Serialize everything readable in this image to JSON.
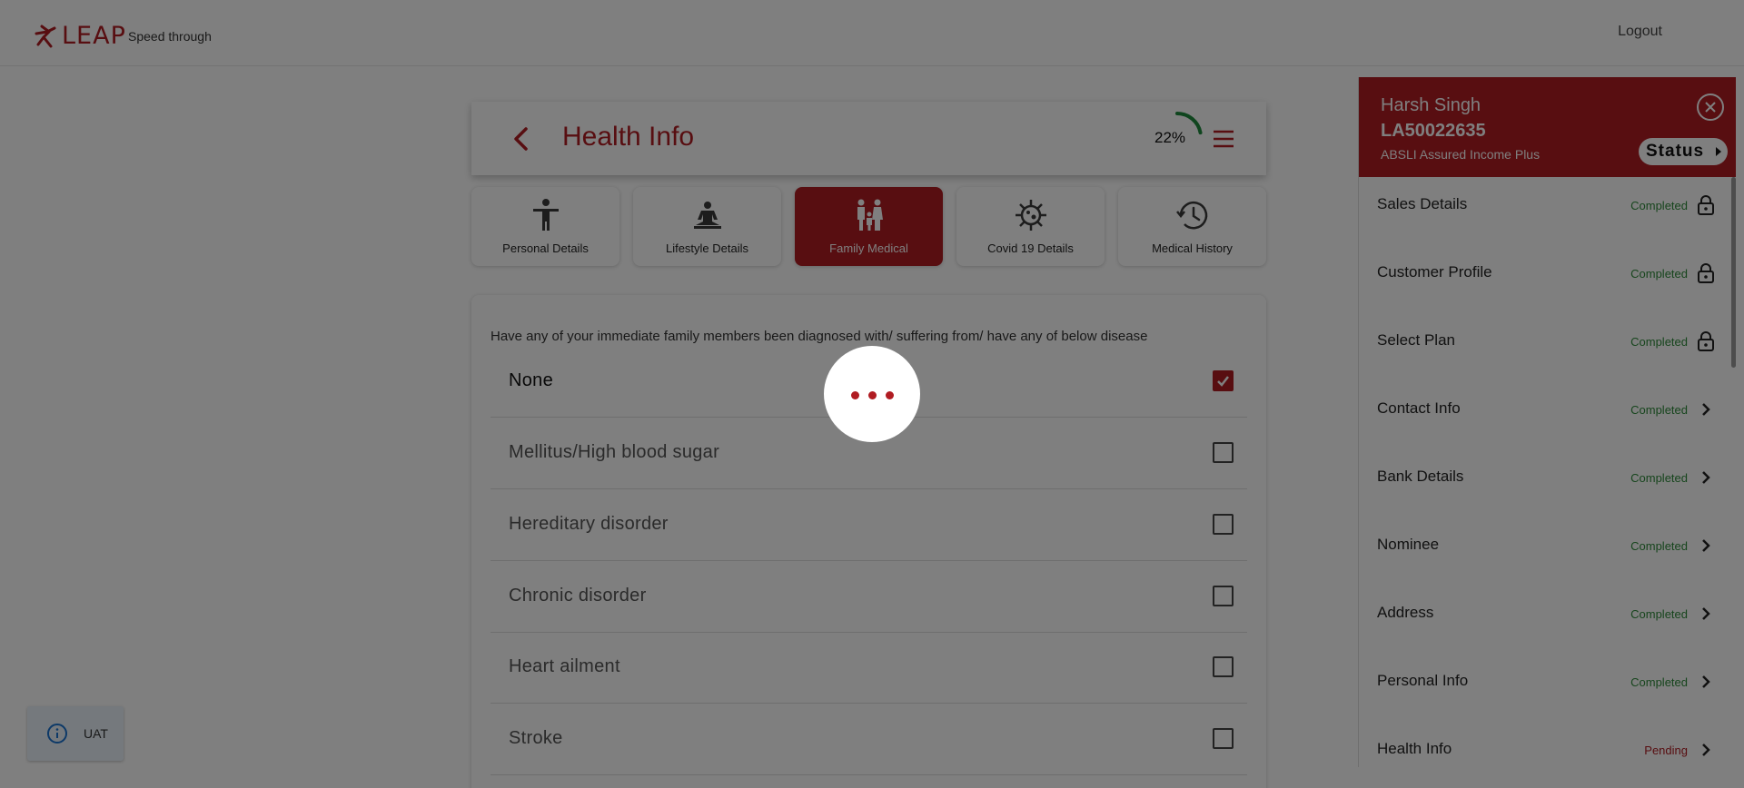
{
  "header": {
    "brand": "LEAP",
    "tagline": "Speed through",
    "logout_label": "Logout"
  },
  "page": {
    "title": "Health Info",
    "progress_percent": 22,
    "progress_label": "22%"
  },
  "tabs": [
    {
      "label": "Personal Details",
      "icon": "person-icon",
      "active": false
    },
    {
      "label": "Lifestyle Details",
      "icon": "meditation-icon",
      "active": false
    },
    {
      "label": "Family Medical",
      "icon": "family-icon",
      "active": true
    },
    {
      "label": "Covid 19 Details",
      "icon": "virus-icon",
      "active": false
    },
    {
      "label": "Medical History",
      "icon": "history-icon",
      "active": false
    }
  ],
  "question": {
    "text": "Have any of your immediate family members been diagnosed with/ suffering from/ have any of below disease",
    "options": [
      {
        "label": "None",
        "checked": true
      },
      {
        "label": "Mellitus/High blood sugar",
        "checked": false
      },
      {
        "label": "Hereditary disorder",
        "checked": false
      },
      {
        "label": "Chronic disorder",
        "checked": false
      },
      {
        "label": "Heart ailment",
        "checked": false
      },
      {
        "label": "Stroke",
        "checked": false
      }
    ]
  },
  "sidebar": {
    "name": "Harsh Singh",
    "application_id": "LA50022635",
    "plan": "ABSLI Assured Income Plus",
    "status_label": "Status",
    "steps": [
      {
        "label": "Sales Details",
        "status": "Completed",
        "icon": "lock-icon"
      },
      {
        "label": "Customer Profile",
        "status": "Completed",
        "icon": "lock-icon"
      },
      {
        "label": "Select Plan",
        "status": "Completed",
        "icon": "lock-icon"
      },
      {
        "label": "Contact Info",
        "status": "Completed",
        "icon": "chevron-right-icon"
      },
      {
        "label": "Bank Details",
        "status": "Completed",
        "icon": "chevron-right-icon"
      },
      {
        "label": "Nominee",
        "status": "Completed",
        "icon": "chevron-right-icon"
      },
      {
        "label": "Address",
        "status": "Completed",
        "icon": "chevron-right-icon"
      },
      {
        "label": "Personal Info",
        "status": "Completed",
        "icon": "chevron-right-icon"
      },
      {
        "label": "Health Info",
        "status": "Pending",
        "icon": "chevron-right-icon"
      }
    ]
  },
  "env_badge": {
    "label": "UAT",
    "icon": "info-icon"
  },
  "colors": {
    "brand": "#b01c22",
    "completed": "#2e8b3a",
    "progress": "#1f8a3c"
  }
}
